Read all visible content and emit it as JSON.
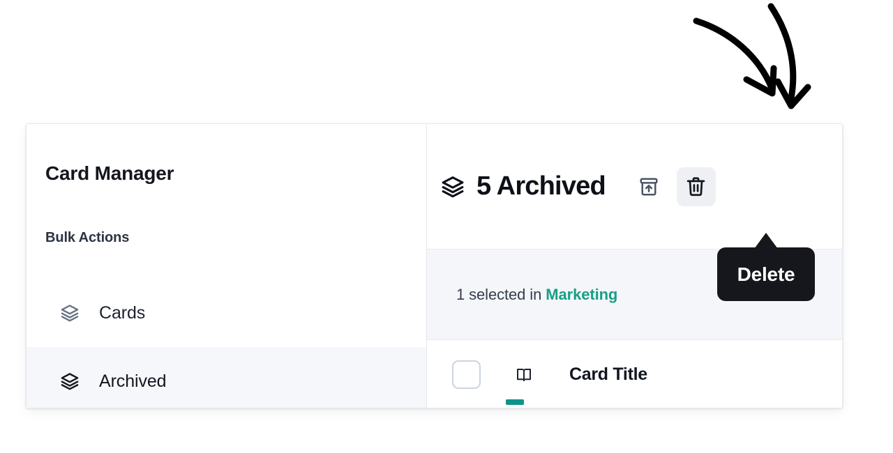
{
  "annotation": {
    "arrows": [
      {
        "name": "curved-arrow-left",
        "points_to": "delete-button"
      },
      {
        "name": "curved-arrow-right",
        "points_to": "delete-button"
      }
    ],
    "color": "#000000"
  },
  "sidebar": {
    "title": "Card Manager",
    "section_label": "Bulk Actions",
    "items": [
      {
        "label": "Cards",
        "icon": "layers-icon",
        "active": false
      },
      {
        "label": "Archived",
        "icon": "layers-icon",
        "active": true
      }
    ]
  },
  "content": {
    "header": {
      "icon": "layers-icon",
      "title": "5 Archived",
      "count": 5,
      "actions": [
        {
          "name": "unarchive-button",
          "icon": "unarchive-icon",
          "label": "Unarchive",
          "hovered": false
        },
        {
          "name": "delete-button",
          "icon": "trash-icon",
          "label": "Delete",
          "hovered": true
        }
      ]
    },
    "status": {
      "prefix": "1 selected in ",
      "scope": "Marketing",
      "selected_count": 1,
      "scope_color": "#16a085"
    },
    "rows": [
      {
        "checkbox_checked": false,
        "type_icon": "book-icon",
        "title": "Card Title",
        "accent_color": "#0d9488"
      }
    ]
  },
  "tooltip": {
    "label": "Delete",
    "target": "delete-button",
    "background": "#15171c"
  }
}
